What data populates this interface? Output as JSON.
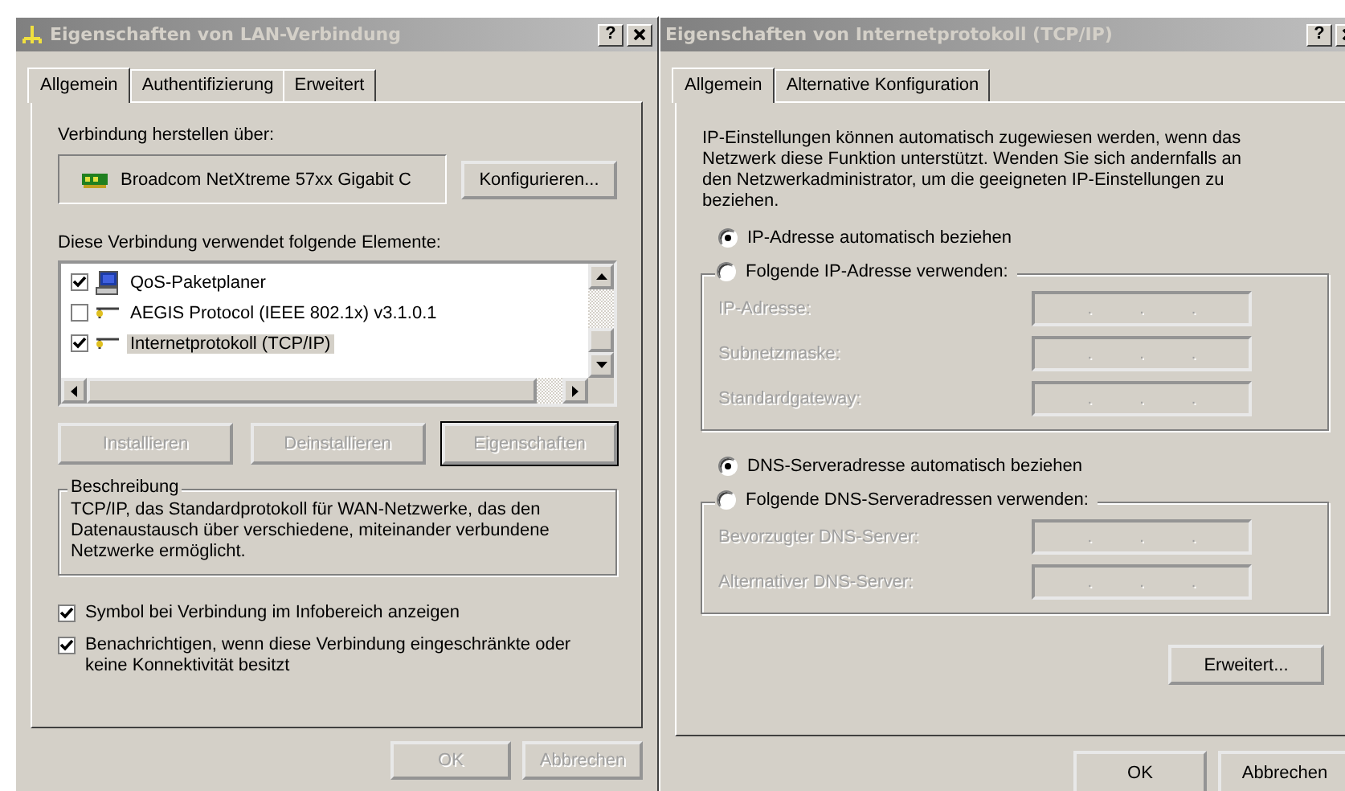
{
  "lan_dialog": {
    "title": "Eigenschaften von LAN-Verbindung",
    "help_button": "?",
    "tabs": [
      {
        "label": "Allgemein",
        "selected": true
      },
      {
        "label": "Authentifizierung",
        "selected": false
      },
      {
        "label": "Erweitert",
        "selected": false
      }
    ],
    "connect_label": "Verbindung herstellen über:",
    "adapter": "Broadcom NetXtreme 57xx Gigabit C",
    "configure_button": "Konfigurieren...",
    "components_label": "Diese Verbindung verwendet folgende Elemente:",
    "components": [
      {
        "label": "QoS-Paketplaner",
        "kind": "scheduler",
        "checked": true,
        "selected": false
      },
      {
        "label": "AEGIS Protocol (IEEE 802.1x) v3.1.0.1",
        "kind": "protocol",
        "checked": false,
        "selected": false
      },
      {
        "label": "Internetprotokoll (TCP/IP)",
        "kind": "protocol",
        "checked": true,
        "selected": true
      }
    ],
    "component_buttons": [
      {
        "label": "Installieren",
        "disabled": true,
        "default": false
      },
      {
        "label": "Deinstallieren",
        "disabled": true,
        "default": false
      },
      {
        "label": "Eigenschaften",
        "disabled": true,
        "default": true
      }
    ],
    "description": {
      "title": "Beschreibung",
      "text": "TCP/IP, das Standardprotokoll für WAN-Netzwerke, das den Datenaustausch über verschiedene, miteinander verbundene Netzwerke ermöglicht."
    },
    "options": [
      {
        "label": "Symbol bei Verbindung im Infobereich anzeigen",
        "checked": true
      },
      {
        "label": "Benachrichtigen, wenn diese Verbindung eingeschränkte oder keine Konnektivität besitzt",
        "checked": true
      }
    ],
    "buttons": [
      {
        "label": "OK",
        "disabled": true
      },
      {
        "label": "Abbrechen",
        "disabled": true
      }
    ]
  },
  "tcpip_dialog": {
    "title": "Eigenschaften von Internetprotokoll (TCP/IP)",
    "help_button": "?",
    "tabs": [
      {
        "label": "Allgemein",
        "selected": true
      },
      {
        "label": "Alternative Konfiguration",
        "selected": false
      }
    ],
    "intro": "IP-Einstellungen können automatisch zugewiesen werden, wenn das Netzwerk diese Funktion unterstützt. Wenden Sie sich andernfalls an den Netzwerkadministrator, um die geeigneten IP-Einstellungen zu beziehen.",
    "sections": [
      {
        "auto_radio": {
          "label": "IP-Adresse automatisch beziehen",
          "selected": true
        },
        "manual_radio": {
          "label": "Folgende IP-Adresse verwenden:",
          "selected": false
        },
        "fields": [
          {
            "label": "IP-Adresse:",
            "disabled": true,
            "dots": [
              ".",
              ".",
              "."
            ]
          },
          {
            "label": "Subnetzmaske:",
            "disabled": true,
            "dots": [
              ".",
              ".",
              "."
            ]
          },
          {
            "label": "Standardgateway:",
            "disabled": true,
            "dots": [
              ".",
              ".",
              "."
            ]
          }
        ]
      },
      {
        "auto_radio": {
          "label": "DNS-Serveradresse automatisch beziehen",
          "selected": true
        },
        "manual_radio": {
          "label": "Folgende DNS-Serveradressen verwenden:",
          "selected": false
        },
        "fields": [
          {
            "label": "Bevorzugter DNS-Server:",
            "disabled": true,
            "dots": [
              ".",
              ".",
              "."
            ]
          },
          {
            "label": "Alternativer DNS-Server:",
            "disabled": true,
            "dots": [
              ".",
              ".",
              "."
            ]
          }
        ]
      }
    ],
    "advanced_button": "Erweitert...",
    "buttons": [
      {
        "label": "OK",
        "disabled": false
      },
      {
        "label": "Abbrechen",
        "disabled": false
      }
    ]
  }
}
